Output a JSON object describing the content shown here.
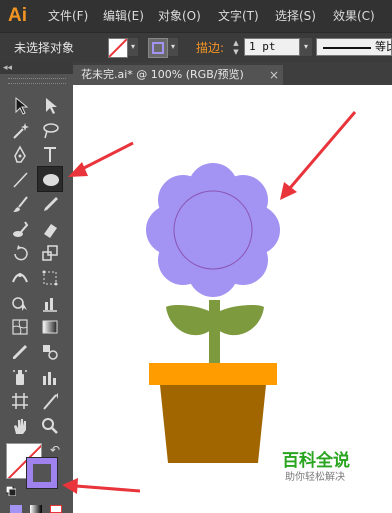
{
  "app": {
    "logo": "Ai"
  },
  "menu": {
    "items": [
      "文件(F)",
      "编辑(E)",
      "对象(O)",
      "文字(T)",
      "选择(S)",
      "效果(C)"
    ]
  },
  "control_bar": {
    "selection_label": "未选择对象",
    "stroke_label": "描边:",
    "stroke_weight": "1 pt",
    "stroke_profile_label": "等比"
  },
  "document": {
    "tab_title": "花未完.ai* @ 100% (RGB/预览)",
    "close_glyph": "×"
  },
  "colors": {
    "accent_orange": "#f29423",
    "flower": "#a393f2",
    "flower_center_stroke": "#8a55b5",
    "leaves": "#7d9a3f",
    "pot_rim": "#ff9c00",
    "pot_body": "#a26600",
    "stroke_swatch": "#9f82ee",
    "arrow": "#e8343a"
  },
  "toolbox": {
    "collapse_glyph": "◂◂",
    "tools": [
      "selection-tool",
      "direct-selection-tool",
      "magic-wand-tool",
      "lasso-tool",
      "pen-tool",
      "type-tool",
      "line-segment-tool",
      "ellipse-tool",
      "paintbrush-tool",
      "pencil-tool",
      "blob-brush-tool",
      "eraser-tool",
      "rotate-tool",
      "scale-tool",
      "width-tool",
      "free-transform-tool",
      "shape-builder-tool",
      "graph-tool",
      "mesh-tool",
      "gradient-tool",
      "eyedropper-tool",
      "blend-tool",
      "symbol-sprayer-tool",
      "column-graph-tool",
      "artboard-tool",
      "slice-tool",
      "hand-tool",
      "zoom-tool"
    ],
    "active_tool": "ellipse-tool",
    "swap_glyph": "↶"
  },
  "watermark": {
    "title": "百科全说",
    "subtitle": "助你轻松解决"
  }
}
